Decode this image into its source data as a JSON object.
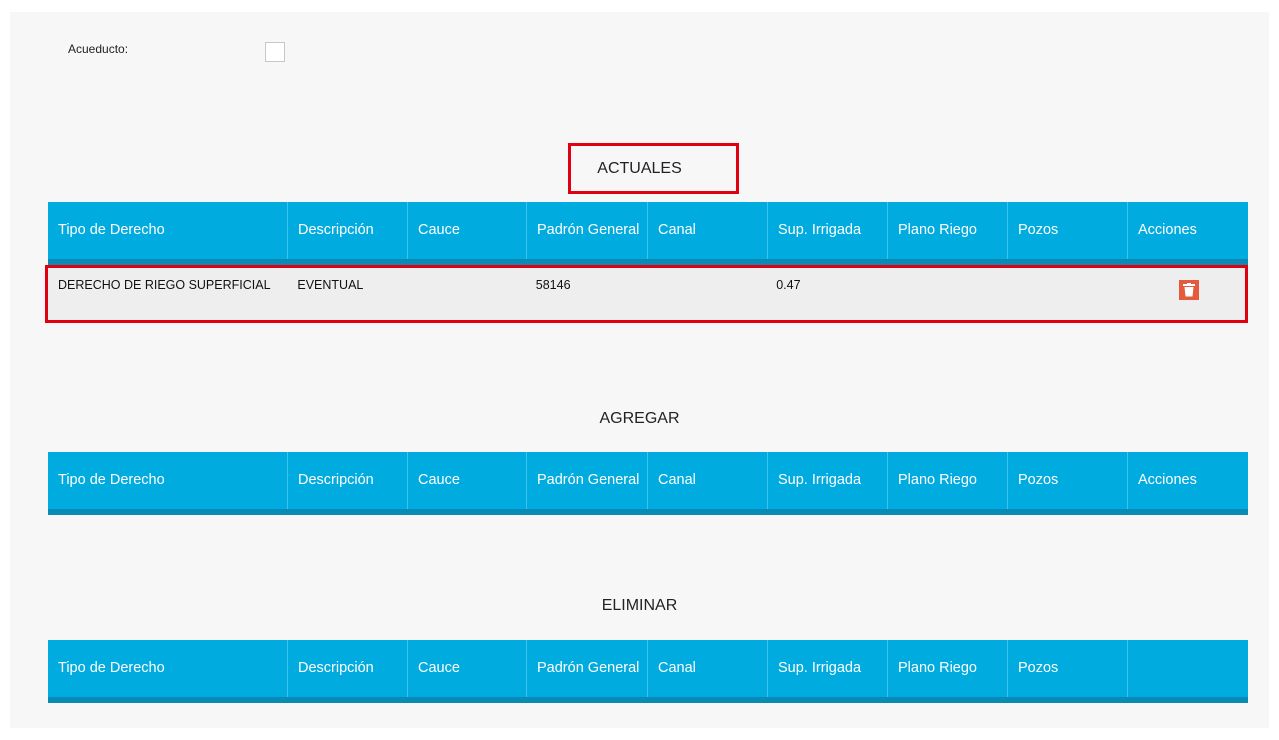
{
  "form": {
    "acueducto_label": "Acueducto:",
    "acueducto_checked": false
  },
  "columns": [
    "Tipo de Derecho",
    "Descripción",
    "Cauce",
    "Padrón General",
    "Canal",
    "Sup. Irrigada",
    "Plano Riego",
    "Pozos",
    "Acciones"
  ],
  "sections": {
    "actuales": {
      "title": "ACTUALES",
      "rows": [
        {
          "tipo": "DERECHO DE RIEGO SUPERFICIAL",
          "descripcion": "EVENTUAL",
          "cauce": "",
          "padron": "58146",
          "canal": "",
          "sup_irrigada": "0.47",
          "plano_riego": "",
          "pozos": "",
          "action_icon": "trash-icon"
        }
      ]
    },
    "agregar": {
      "title": "AGREGAR",
      "rows": []
    },
    "eliminar": {
      "title": "ELIMINAR",
      "rows": []
    }
  },
  "eliminar_columns": [
    "Tipo de Derecho",
    "Descripción",
    "Cauce",
    "Padrón General",
    "Canal",
    "Sup. Irrigada",
    "Plano Riego",
    "Pozos",
    ""
  ],
  "colors": {
    "header_bg": "#00abe0",
    "header_border": "#0a8ab5",
    "highlight": "#e10012",
    "delete_button": "#e5593c"
  }
}
